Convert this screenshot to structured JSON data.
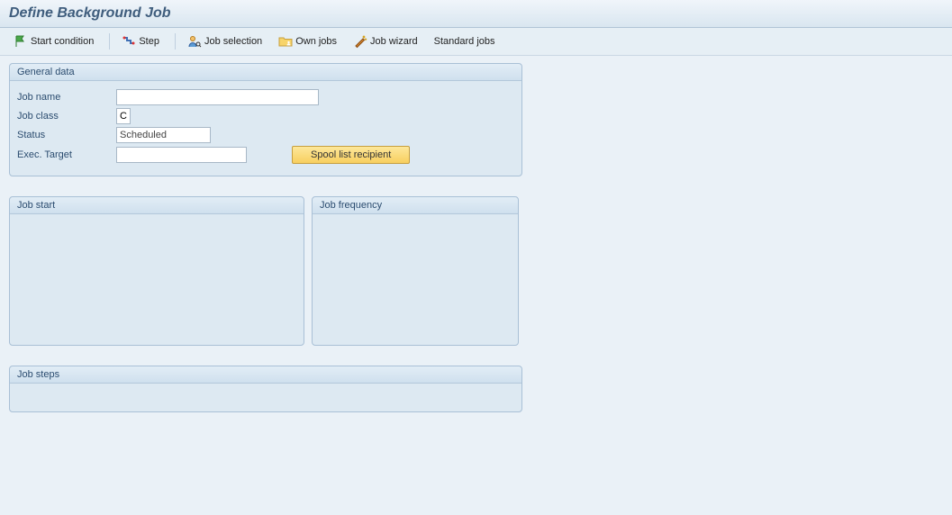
{
  "title": "Define Background Job",
  "toolbar": {
    "start_condition": "Start condition",
    "step": "Step",
    "job_selection": "Job selection",
    "own_jobs": "Own jobs",
    "job_wizard": "Job wizard",
    "standard_jobs": "Standard jobs"
  },
  "general_data": {
    "header": "General data",
    "labels": {
      "job_name": "Job name",
      "job_class": "Job class",
      "status": "Status",
      "exec_target": "Exec. Target"
    },
    "values": {
      "job_name": "",
      "job_class": "C",
      "status": "Scheduled",
      "exec_target": ""
    },
    "spool_button": "Spool list recipient"
  },
  "job_start": {
    "header": "Job start"
  },
  "job_frequency": {
    "header": "Job frequency"
  },
  "job_steps": {
    "header": "Job steps"
  },
  "colors": {
    "accent_button": "#F8CF5F",
    "panel_bg": "#DDE9F2",
    "panel_border": "#A9C0D6"
  }
}
